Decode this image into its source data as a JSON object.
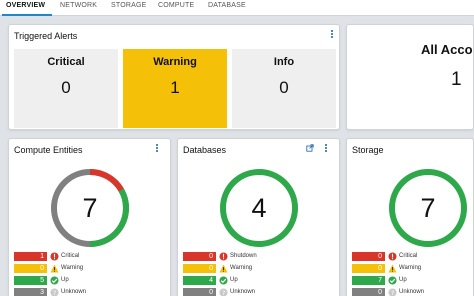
{
  "tabs": [
    {
      "label": "OVERVIEW",
      "active": true
    },
    {
      "label": "NETWORK",
      "active": false
    },
    {
      "label": "STORAGE",
      "active": false
    },
    {
      "label": "COMPUTE",
      "active": false
    },
    {
      "label": "DATABASE",
      "active": false
    }
  ],
  "triggered_alerts": {
    "title": "Triggered Alerts",
    "tiles": [
      {
        "label": "Critical",
        "value": "0"
      },
      {
        "label": "Warning",
        "value": "1"
      },
      {
        "label": "Info",
        "value": "0"
      }
    ]
  },
  "accounts": {
    "label": "All Accoun",
    "value": "1"
  },
  "compute": {
    "title": "Compute Entities",
    "total": "7",
    "legend": [
      {
        "count": "1",
        "label": "Critical"
      },
      {
        "count": "0",
        "label": "Warning"
      },
      {
        "count": "5",
        "label": "Up"
      },
      {
        "count": "3",
        "label": "Unknown"
      }
    ]
  },
  "databases": {
    "title": "Databases",
    "total": "4",
    "legend": [
      {
        "count": "0",
        "label": "Shutdown"
      },
      {
        "count": "0",
        "label": "Warning"
      },
      {
        "count": "4",
        "label": "Up"
      },
      {
        "count": "0",
        "label": "Unknown"
      }
    ]
  },
  "storage": {
    "title": "Storage",
    "total": "7",
    "legend": [
      {
        "count": "0",
        "label": "Critical"
      },
      {
        "count": "0",
        "label": "Warning"
      },
      {
        "count": "7",
        "label": "Up"
      },
      {
        "count": "0",
        "label": "Unknown"
      }
    ]
  },
  "colors": {
    "critical": "#d9362b",
    "warning": "#f5c108",
    "up": "#2ea84a",
    "unknown": "#808080",
    "accent": "#1e88c8"
  },
  "icons": [
    "kebab-menu-icon",
    "external-link-icon",
    "critical-status-icon",
    "warning-status-icon",
    "up-status-icon",
    "unknown-status-icon"
  ]
}
